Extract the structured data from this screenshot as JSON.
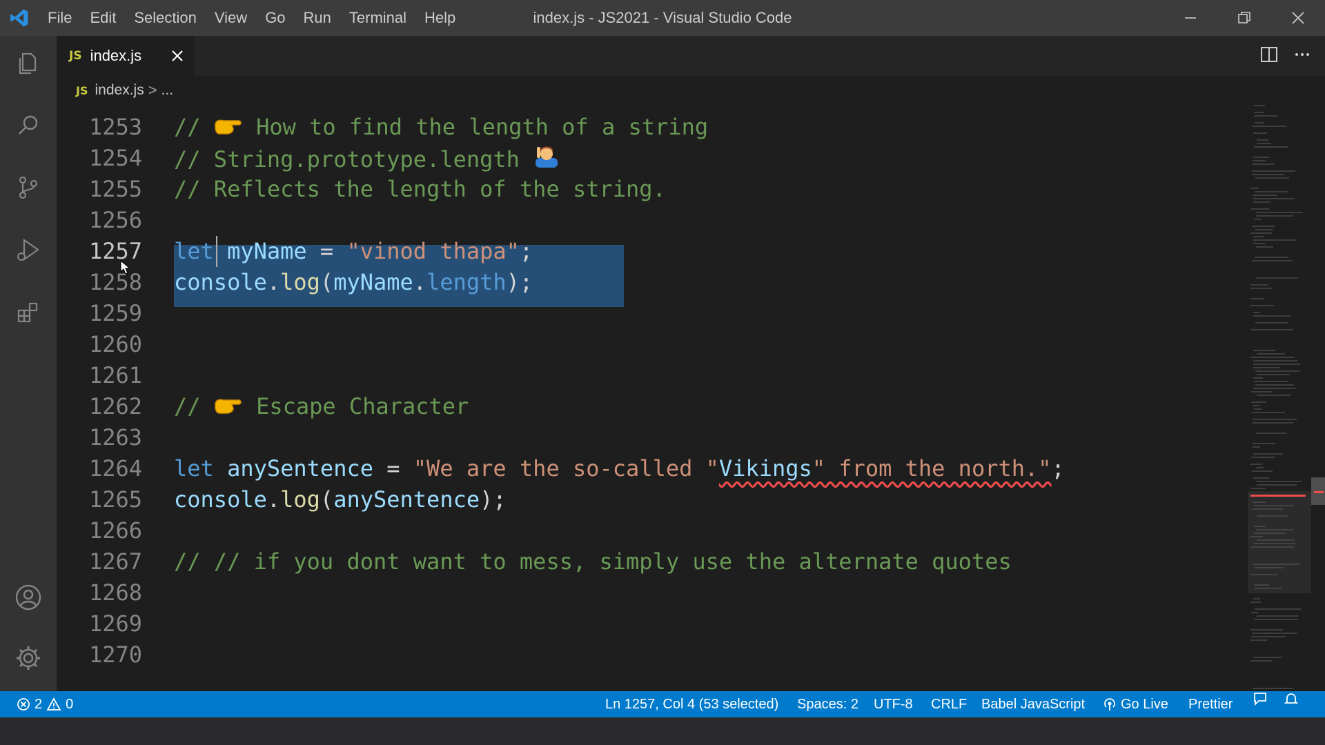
{
  "window": {
    "title": "index.js - JS2021 - Visual Studio Code"
  },
  "menu": [
    "File",
    "Edit",
    "Selection",
    "View",
    "Go",
    "Run",
    "Terminal",
    "Help"
  ],
  "activity_bar": [
    "explorer-icon",
    "search-icon",
    "source-control-icon",
    "run-debug-icon",
    "extensions-icon",
    "account-icon",
    "settings-gear-icon"
  ],
  "tab": {
    "badge": "JS",
    "label": "index.js"
  },
  "breadcrumb": {
    "badge": "JS",
    "file": "index.js",
    "separator": ">",
    "more": "..."
  },
  "editor": {
    "lines": [
      {
        "n": "1253"
      },
      {
        "n": "1254"
      },
      {
        "n": "1255"
      },
      {
        "n": "1256"
      },
      {
        "n": "1257"
      },
      {
        "n": "1258"
      },
      {
        "n": "1259"
      },
      {
        "n": "1260"
      },
      {
        "n": "1261"
      },
      {
        "n": "1262"
      },
      {
        "n": "1263"
      },
      {
        "n": "1264"
      },
      {
        "n": "1265"
      },
      {
        "n": "1266"
      },
      {
        "n": "1267"
      },
      {
        "n": "1268"
      },
      {
        "n": "1269"
      },
      {
        "n": "1270"
      }
    ],
    "code": {
      "l1253_slash": "//",
      "l1253_text": "How to find the length of a string",
      "l1254_text": "// String.prototype.length",
      "l1255_text": "// Reflects the length of the string.",
      "l1257_let": "let",
      "l1257_var": "myName",
      "l1257_eq": " = ",
      "l1257_str": "\"vinod thapa\"",
      "l1257_end": ";",
      "l1258_obj": "console",
      "l1258_dot": ".",
      "l1258_fn": "log",
      "l1258_open": "(",
      "l1258_var": "myName",
      "l1258_dot2": ".",
      "l1258_prop": "length",
      "l1258_close": ");",
      "l1262_slash": "//",
      "l1262_text": "Escape Character",
      "l1264_let": "let",
      "l1264_var": "anySentence",
      "l1264_eq": " = ",
      "l1264_str1": "\"We are the so-called \"",
      "l1264_ident": "Vikings",
      "l1264_str2": "\" from the north.\"",
      "l1264_end": ";",
      "l1265_obj": "console",
      "l1265_dot": ".",
      "l1265_fn": "log",
      "l1265_open": "(",
      "l1265_var": "anySentence",
      "l1265_close": ");",
      "l1267_text": "// // if you dont want to mess, simply use the alternate quotes"
    },
    "selection": {
      "from": "Ln 1257, Col 4",
      "to": "Ln 1258, end"
    }
  },
  "status": {
    "errors": "2",
    "warnings": "0",
    "cursor": "Ln 1257, Col 4 (53 selected)",
    "spaces": "Spaces: 2",
    "encoding": "UTF-8",
    "eol": "CRLF",
    "language": "Babel JavaScript",
    "golive": "Go Live",
    "prettier": "Prettier"
  },
  "colors": {
    "titlebar": "#3c3c3c",
    "activitybar": "#333333",
    "editor_bg": "#1e1e1e",
    "statusbar": "#007acc",
    "selection": "#264f78",
    "comment": "#6a9955",
    "keyword": "#569cd6",
    "string": "#ce9178"
  }
}
